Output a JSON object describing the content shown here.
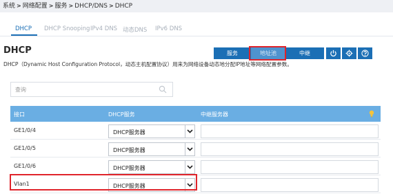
{
  "breadcrumb": [
    "系统",
    "网络配置",
    "服务",
    "DHCP/DNS",
    "DHCP"
  ],
  "tabs": [
    {
      "label": "DHCP",
      "active": true
    },
    {
      "label": "DHCP Snooping",
      "active": false
    },
    {
      "label": "IPv4 DNS",
      "active": false
    },
    {
      "label": "动态DNS",
      "active": false
    },
    {
      "label": "IPv6 DNS",
      "active": false
    }
  ],
  "page": {
    "title": "DHCP",
    "description": "DHCP（Dynamic Host Configuration Protocol，动态主机配置协议）用来为网络设备动态地分配IP地址等网络配置参数。"
  },
  "toolbar": {
    "service_label": "服务",
    "pool_label": "地址池",
    "relay_label": "中继",
    "icons": [
      "power-icon",
      "gear-icon",
      "help-icon"
    ]
  },
  "search": {
    "placeholder": "查询"
  },
  "table": {
    "headers": {
      "iface": "接口",
      "service": "DHCP服务",
      "relay": "中继服务器"
    },
    "rows": [
      {
        "iface": "GE1/0/4",
        "service": "DHCP服务器",
        "relay": ""
      },
      {
        "iface": "GE1/0/5",
        "service": "DHCP服务器",
        "relay": ""
      },
      {
        "iface": "GE1/0/6",
        "service": "DHCP服务器",
        "relay": ""
      },
      {
        "iface": "Vlan1",
        "service": "DHCP服务器",
        "relay": ""
      }
    ]
  },
  "colors": {
    "accent": "#1b6fb5",
    "header": "#6aaee3",
    "highlight": "#e0232a"
  }
}
